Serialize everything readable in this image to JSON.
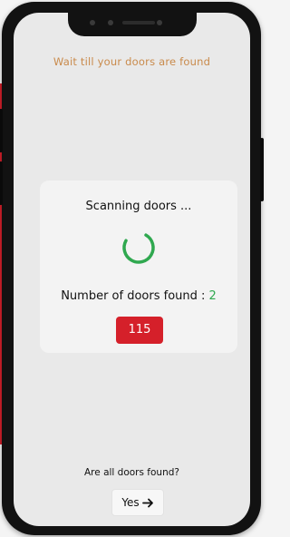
{
  "header": {
    "instruction": "Wait till your doors are found"
  },
  "scan": {
    "title": "Scanning doors ...",
    "count_label": "Number of doors found :",
    "count_value": "2",
    "badge_value": "115"
  },
  "confirm": {
    "question": "Are all doors found?",
    "yes_label": "Yes"
  },
  "colors": {
    "accent_text": "#c98a4b",
    "spinner_green": "#2fa84f",
    "badge_red": "#d5202a"
  },
  "icons": {
    "spinner": "loading-spinner-icon",
    "yes_arrow": "arrow-right-icon"
  }
}
